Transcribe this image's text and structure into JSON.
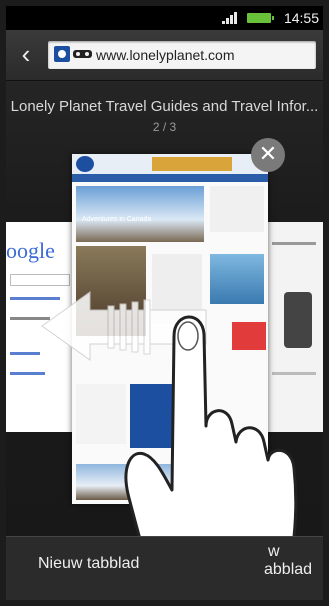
{
  "status": {
    "time": "14:55"
  },
  "toolbar": {
    "url": "www.lonelyplanet.com"
  },
  "page": {
    "title": "Lonely Planet Travel Guides and Travel Infor...",
    "counter": "2 / 3"
  },
  "tabs": {
    "left_preview_text": "oogle",
    "main_preview_headline": "Adventures in Canada"
  },
  "bottom": {
    "new_tab_label": "Nieuw tabblad",
    "right_label_top": "w",
    "right_label": "abblad"
  },
  "colors": {
    "accent": "#67c23a"
  }
}
